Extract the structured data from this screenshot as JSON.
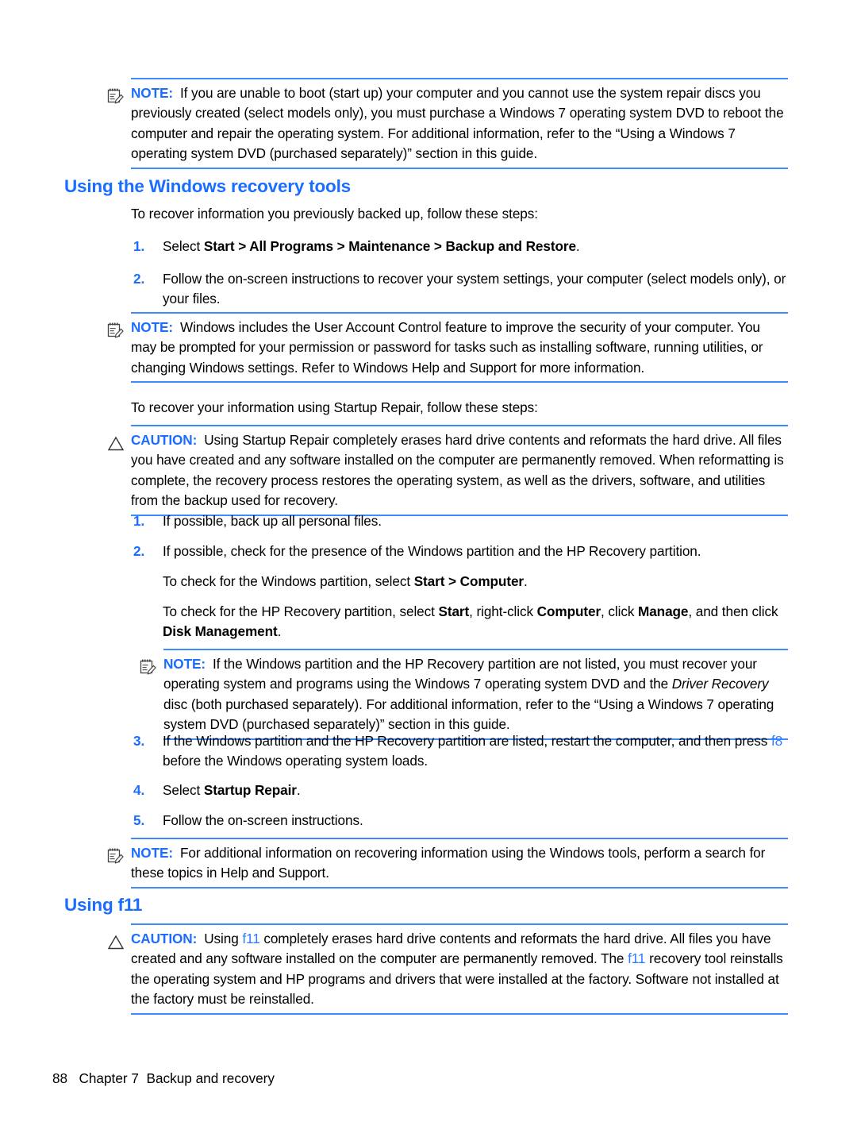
{
  "document": {
    "page_number": "88",
    "chapter": "Chapter 7",
    "chapter_title": "Backup and recovery"
  },
  "colors": {
    "heading_blue": "#1a6dff",
    "rule_blue": "#3d8bff",
    "key_blue": "#2b7dff",
    "text_black": "#000000"
  },
  "note1": {
    "icon": "note-pencil-icon",
    "label": "NOTE:",
    "text": "If you are unable to boot (start up) your computer and you cannot use the system repair discs you previously created (select models only), you must purchase a Windows 7 operating system DVD to reboot the computer and repair the operating system. For additional information, refer to the “Using a Windows 7 operating system DVD (purchased separately)” section in this guide."
  },
  "heading1": {
    "text": "Using the Windows recovery tools"
  },
  "intro1": {
    "text": "To recover information you previously backed up, follow these steps:"
  },
  "list1": [
    {
      "num": "1.",
      "pre": "Select ",
      "bold": "Start > All Programs > Maintenance > Backup and Restore",
      "post": "."
    },
    {
      "num": "2.",
      "pre": "Follow the on-screen instructions to recover your system settings, your computer (select models only), or your files.",
      "bold": "",
      "post": ""
    }
  ],
  "note2": {
    "icon": "note-pencil-icon",
    "label": "NOTE:",
    "text": "Windows includes the User Account Control feature to improve the security of your computer. You may be prompted for your permission or password for tasks such as installing software, running utilities, or changing Windows settings. Refer to Windows Help and Support for more information."
  },
  "intro2": {
    "text": "To recover your information using Startup Repair, follow these steps:"
  },
  "caution1": {
    "icon": "caution-triangle-icon",
    "label": "CAUTION:",
    "text": "Using Startup Repair completely erases hard drive contents and reformats the hard drive. All files you have created and any software installed on the computer are permanently removed. When reformatting is complete, the recovery process restores the operating system, as well as the drivers, software, and utilities from the backup used for recovery."
  },
  "list2": {
    "item1": {
      "num": "1.",
      "text": "If possible, back up all personal files."
    },
    "item2": {
      "num": "2.",
      "text": "If possible, check for the presence of the Windows partition and the HP Recovery partition."
    },
    "item2_sub1": {
      "pre": "To check for the Windows partition, select ",
      "bold": "Start > Computer",
      "post": "."
    },
    "item2_sub2": {
      "pre": "To check for the HP Recovery partition, select ",
      "bold1": "Start",
      "mid1": ", right-click ",
      "bold2": "Computer",
      "mid2": ", click ",
      "bold3": "Manage",
      "mid3": ", and then click ",
      "bold4": "Disk Management",
      "post": "."
    },
    "item3": {
      "num": "3.",
      "pre": "If the Windows partition and the HP Recovery partition are listed, restart the computer, and then press ",
      "key": "f8",
      "post": " before the Windows operating system loads."
    },
    "item4": {
      "num": "4.",
      "pre": "Select ",
      "bold": "Startup Repair",
      "post": "."
    },
    "item5": {
      "num": "5.",
      "text": "Follow the on-screen instructions."
    }
  },
  "note3": {
    "icon": "note-pencil-icon",
    "label": "NOTE:",
    "pre": "If the Windows partition and the HP Recovery partition are not listed, you must recover your operating system and programs using the Windows 7 operating system DVD and the ",
    "italic": "Driver Recovery",
    "post": " disc (both purchased separately). For additional information, refer to the “Using a Windows 7 operating system DVD (purchased separately)” section in this guide."
  },
  "note4": {
    "icon": "note-pencil-icon",
    "label": "NOTE:",
    "text": "For additional information on recovering information using the Windows tools, perform a search for these topics in Help and Support."
  },
  "heading2": {
    "text": "Using f11"
  },
  "caution2": {
    "icon": "caution-triangle-icon",
    "label": "CAUTION:",
    "pre": "Using ",
    "key1": "f11",
    "mid": " completely erases hard drive contents and reformats the hard drive. All files you have created and any software installed on the computer are permanently removed. The ",
    "key2": "f11",
    "post": " recovery tool reinstalls the operating system and HP programs and drivers that were installed at the factory. Software not installed at the factory must be reinstalled."
  }
}
